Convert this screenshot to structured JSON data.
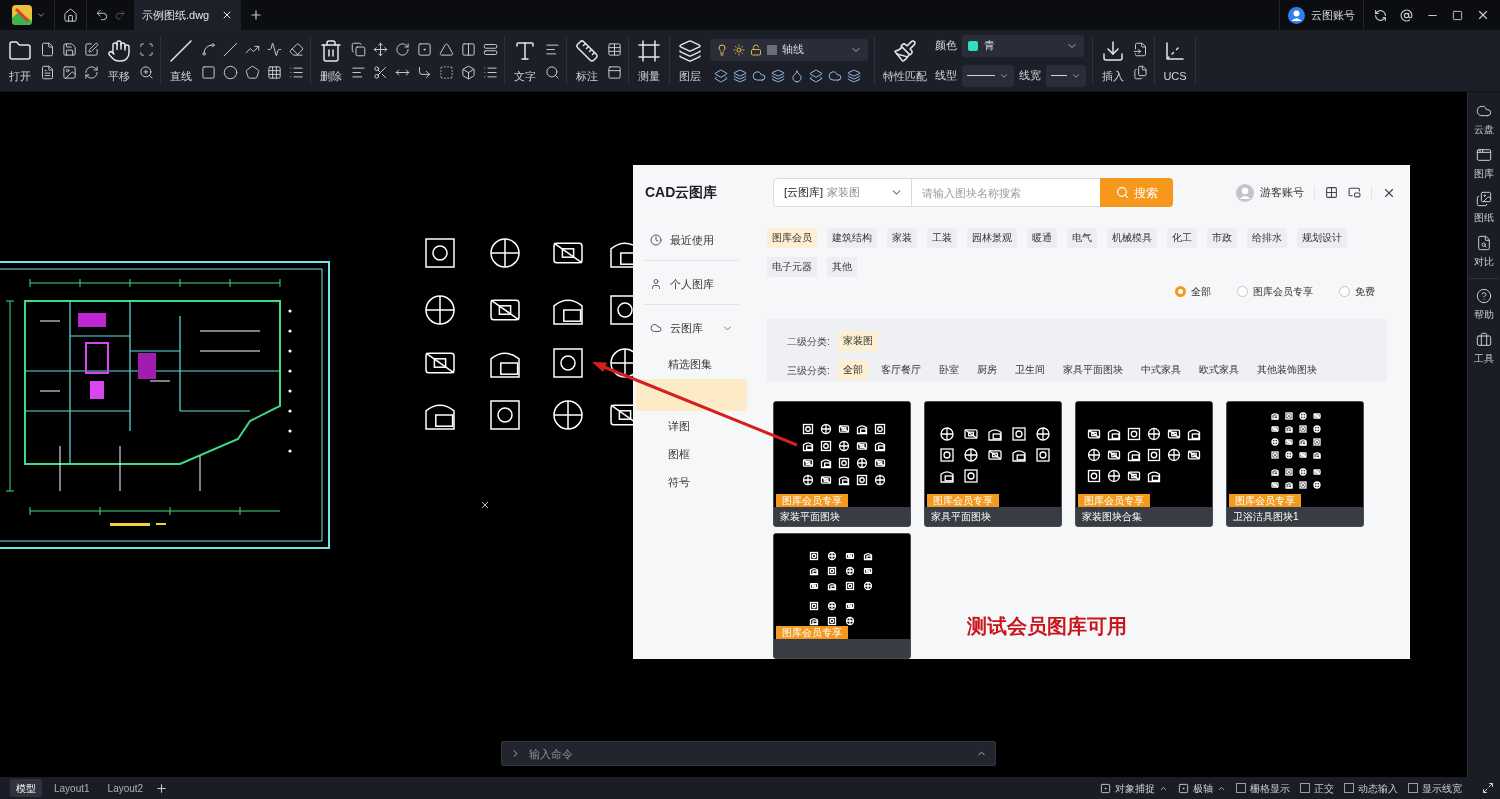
{
  "title_bar": {
    "tabs": [
      {
        "label": "示例图纸.dwg",
        "selected": true
      }
    ],
    "user": "云图账号"
  },
  "toolbar": {
    "groups": [
      {
        "kind": "file",
        "tools": [
          {
            "label": "打开"
          },
          {
            "label": "平移"
          }
        ]
      },
      {
        "kind": "draw",
        "tools": [
          {
            "label": "直线"
          }
        ]
      },
      {
        "kind": "modify",
        "tools": [
          {
            "label": "删除"
          }
        ]
      },
      {
        "kind": "text",
        "tools": [
          {
            "label": "文字"
          }
        ]
      },
      {
        "kind": "dimension",
        "tools": [
          {
            "label": "标注"
          }
        ]
      },
      {
        "kind": "measure",
        "tools": [
          {
            "label": "测量"
          }
        ]
      },
      {
        "kind": "layer",
        "tools": [
          {
            "label": "图层"
          }
        ],
        "layer": "轴线"
      },
      {
        "kind": "properties",
        "tools": [
          {
            "label": "特性匹配"
          }
        ],
        "color_label": "颜色",
        "color_value": "青",
        "linetype_label": "线型",
        "lineweight_label": "线宽"
      },
      {
        "kind": "insert",
        "tools": [
          {
            "label": "插入"
          }
        ]
      },
      {
        "kind": "ucs",
        "tools": [
          {
            "label": "UCS"
          }
        ]
      }
    ]
  },
  "library": {
    "title": "CAD云图库",
    "scope": "[云图库]",
    "scope_value": "家装图",
    "search_placeholder": "请输入图块名称搜索",
    "search_button": "搜索",
    "user": "游客账号",
    "nav": [
      {
        "label": "最近使用",
        "kind": "recent"
      },
      {
        "label": "个人图库",
        "kind": "personal"
      },
      {
        "label": "云图库",
        "kind": "cloud",
        "expanded": true,
        "children": [
          {
            "label": "精选图集",
            "selected": false
          },
          {
            "selected": true
          },
          {
            "label": "详图",
            "selected": false
          },
          {
            "label": "图框",
            "selected": false
          },
          {
            "label": "符号",
            "selected": false
          }
        ]
      }
    ],
    "categories": [
      {
        "label": "图库会员",
        "selected": true
      },
      {
        "label": "建筑结构",
        "selected": false
      },
      {
        "label": "家装",
        "selected": false
      },
      {
        "label": "工装",
        "selected": false
      },
      {
        "label": "园林景观",
        "selected": false
      },
      {
        "label": "暖通",
        "selected": false
      },
      {
        "label": "电气",
        "selected": false
      },
      {
        "label": "机械模具",
        "selected": false
      },
      {
        "label": "化工",
        "selected": false
      },
      {
        "label": "市政",
        "selected": false
      },
      {
        "label": "给排水",
        "selected": false
      },
      {
        "label": "规划设计",
        "selected": false
      },
      {
        "label": "电子元器",
        "selected": false
      },
      {
        "label": "其他",
        "selected": false
      }
    ],
    "access_filter": [
      {
        "label": "全部",
        "selected": true
      },
      {
        "label": "图库会员专享",
        "selected": false
      },
      {
        "label": "免费",
        "selected": false
      }
    ],
    "level2": {
      "label": "二级分类:",
      "options": [
        {
          "label": "家装图",
          "selected": true
        }
      ]
    },
    "level3": {
      "label": "三级分类:",
      "options": [
        {
          "label": "全部",
          "selected": true
        },
        {
          "label": "客厅餐厅",
          "selected": false
        },
        {
          "label": "卧室",
          "selected": false
        },
        {
          "label": "厨房",
          "selected": false
        },
        {
          "label": "卫生间",
          "selected": false
        },
        {
          "label": "家具平面图块",
          "selected": false
        },
        {
          "label": "中式家具",
          "selected": false
        },
        {
          "label": "欧式家具",
          "selected": false
        },
        {
          "label": "其他装饰图块",
          "selected": false
        }
      ]
    },
    "cards": [
      {
        "badge": "图库会员专享",
        "caption": "家装平面图块"
      },
      {
        "badge": "图库会员专享",
        "caption": "家具平面图块"
      },
      {
        "badge": "图库会员专享",
        "caption": "家装图块合集"
      },
      {
        "badge": "图库会员专享",
        "caption": "卫浴洁具图块1"
      },
      {
        "badge": "图库会员专享"
      }
    ],
    "annotation": "测试会员图库可用"
  },
  "command_line": {
    "placeholder": "输入命令"
  },
  "right_panel": [
    {
      "label": "云盘"
    },
    {
      "label": "图库"
    },
    {
      "label": "图纸"
    },
    {
      "label": "对比"
    },
    {
      "label": "帮助"
    },
    {
      "label": "工具"
    }
  ],
  "layout_tabs": [
    {
      "label": "模型",
      "selected": true
    },
    {
      "label": "Layout1",
      "selected": false
    },
    {
      "label": "Layout2",
      "selected": false
    }
  ],
  "status_bar": [
    {
      "label": "对象捕捉",
      "kind": "menu"
    },
    {
      "label": "极轴",
      "kind": "menu"
    },
    {
      "label": "栅格显示",
      "kind": "checkbox",
      "checked": false
    },
    {
      "label": "正交",
      "kind": "checkbox",
      "checked": false
    },
    {
      "label": "动态输入",
      "kind": "checkbox",
      "checked": false
    },
    {
      "label": "显示线宽",
      "kind": "checkbox",
      "checked": false
    }
  ]
}
